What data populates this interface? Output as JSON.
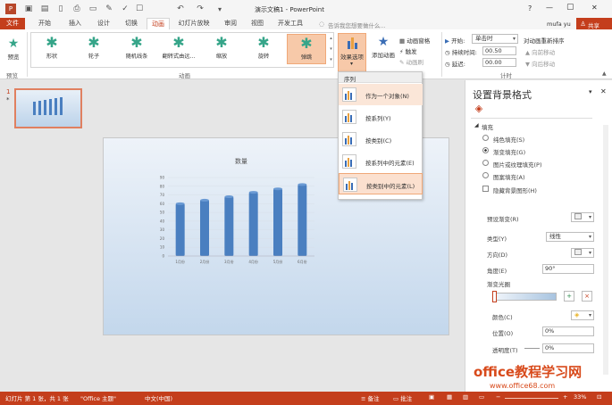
{
  "titlebar": {
    "title": "演示文稿1 - PowerPoint",
    "help": "?",
    "min": "—",
    "max": "▢",
    "close": "✕"
  },
  "tabs": {
    "file": "文件",
    "home": "开始",
    "insert": "插入",
    "design": "设计",
    "transitions": "切换",
    "animations": "动画",
    "slideshow": "幻灯片放映",
    "review": "审阅",
    "view": "视图",
    "developer": "开发工具",
    "search_placeholder": "告诉我您想要做什么...",
    "user": "mufa yu",
    "share": "共享"
  },
  "ribbon": {
    "preview": "预览",
    "preview_group": "预览",
    "animation_group": "动画",
    "effects": [
      "形状",
      "轮子",
      "随机线条",
      "翻转式由远...",
      "缩放",
      "旋转",
      "弹跳"
    ],
    "effect_options": "效果选项",
    "add_animation": "添加动画",
    "animation_pane": "动画窗格",
    "trigger": "触发",
    "animation_painter": "动画刷",
    "start_label": "开始:",
    "start_value": "单击时",
    "duration_label": "持续时间:",
    "duration_value": "00.50",
    "delay_label": "延迟:",
    "delay_value": "00.00",
    "reorder_title": "对动画重新排序",
    "move_earlier": "向前移动",
    "move_later": "向后移动",
    "timing_group": "计时"
  },
  "dropdown": {
    "header": "序列",
    "items": [
      "作为一个对象(N)",
      "按系列(Y)",
      "按类别(C)",
      "按系列中的元素(E)",
      "按类别中的元素(L)"
    ]
  },
  "thumbnail": {
    "number": "1",
    "star": "*"
  },
  "chart_data": {
    "type": "bar",
    "title": "数量",
    "categories": [
      "1月份",
      "2月份",
      "3月份",
      "4月份",
      "5月份",
      "6月份"
    ],
    "values": [
      60,
      64,
      68,
      73,
      77,
      82
    ],
    "ylim": [
      0,
      90
    ],
    "yticks": [
      "0",
      "10",
      "20",
      "30",
      "40",
      "50",
      "60",
      "70",
      "80",
      "90"
    ],
    "color": "#4a7fc0"
  },
  "format_pane": {
    "title": "设置背景格式",
    "fill_header": "填充",
    "options": [
      "纯色填充(S)",
      "渐变填充(G)",
      "图片或纹理填充(P)",
      "图案填充(A)"
    ],
    "hide_bg": "隐藏背景图形(H)",
    "preset_label": "预设渐变(R)",
    "type_label": "类型(Y)",
    "type_value": "线性",
    "direction_label": "方向(D)",
    "angle_label": "角度(E)",
    "angle_value": "90°",
    "stops_label": "渐变光圈",
    "color_label": "颜色(C)",
    "position_label": "位置(O)",
    "position_value": "0%",
    "transparency_label": "透明度(T)",
    "transparency_value": "0%"
  },
  "watermark": {
    "line1": "office教程学习网",
    "line2": "www.office68.com"
  },
  "statusbar": {
    "slide": "幻灯片 第 1 张，共 1 张",
    "theme": "\"Office 主题\"",
    "lang": "中文(中国)",
    "notes": "备注",
    "comments": "批注",
    "zoom": "33%"
  },
  "colors": {
    "accent": "#c43e1c",
    "bar": "#4a7fc0"
  }
}
